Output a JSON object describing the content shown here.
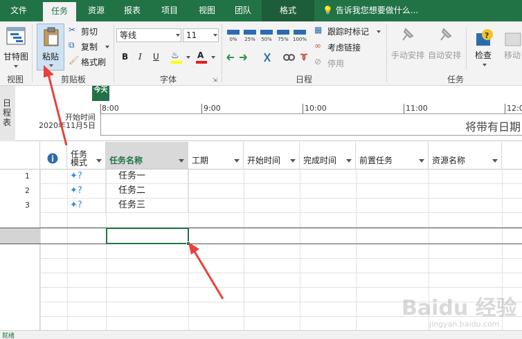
{
  "tabs": [
    {
      "label": "文件",
      "key": "file"
    },
    {
      "label": "任务",
      "key": "task"
    },
    {
      "label": "资源",
      "key": "resource"
    },
    {
      "label": "报表",
      "key": "report"
    },
    {
      "label": "项目",
      "key": "project"
    },
    {
      "label": "视图",
      "key": "view"
    },
    {
      "label": "团队",
      "key": "team"
    },
    {
      "label": "格式",
      "key": "format"
    }
  ],
  "tell_me": "告诉我您想要做什么...",
  "ribbon": {
    "view_group": {
      "label": "视图",
      "gantt": "甘特图"
    },
    "clipboard_group": {
      "label": "剪贴板",
      "paste": "粘贴",
      "cut": "剪切",
      "copy": "复制",
      "format_painter": "格式刷"
    },
    "font_group": {
      "label": "字体",
      "font_name": "等线",
      "font_size": "11",
      "bold": "B",
      "italic": "I",
      "underline": "U"
    },
    "schedule_group": {
      "label": "日程",
      "percent_labels": [
        "0%",
        "25%",
        "50%",
        "75%",
        "100%"
      ],
      "mark_on_track": "跟踪时标记",
      "respect_links": "考虑链接",
      "inactivate": "停用"
    },
    "tasks_group": {
      "label": "任务",
      "manual": "手动安排",
      "auto": "自动安排",
      "inspect": "检查",
      "move": "移动"
    }
  },
  "timeline": {
    "side_label": "日程表",
    "today": "今天",
    "start_label": "开始时间",
    "start_date": "2020年11月5日",
    "ticks": [
      "8:00",
      "9:00",
      "10:00",
      "11:00",
      "12:0"
    ],
    "bar_text": "将带有日期"
  },
  "grid": {
    "columns": [
      {
        "key": "info",
        "label": ""
      },
      {
        "key": "mode",
        "label": "任务\n模式"
      },
      {
        "key": "name",
        "label": "任务名称"
      },
      {
        "key": "duration",
        "label": "工期"
      },
      {
        "key": "start",
        "label": "开始时间"
      },
      {
        "key": "finish",
        "label": "完成时间"
      },
      {
        "key": "pred",
        "label": "前置任务"
      },
      {
        "key": "res",
        "label": "资源名称"
      }
    ],
    "rows": [
      {
        "num": "1",
        "name": "任务一"
      },
      {
        "num": "2",
        "name": "任务二"
      },
      {
        "num": "3",
        "name": "任务三"
      }
    ]
  },
  "status_text": "就绪",
  "watermark": "Baidu 经验",
  "watermark_sub": "jingyan.baidu.com",
  "colors": {
    "accent": "#217346",
    "arrow": "#e8413b"
  }
}
